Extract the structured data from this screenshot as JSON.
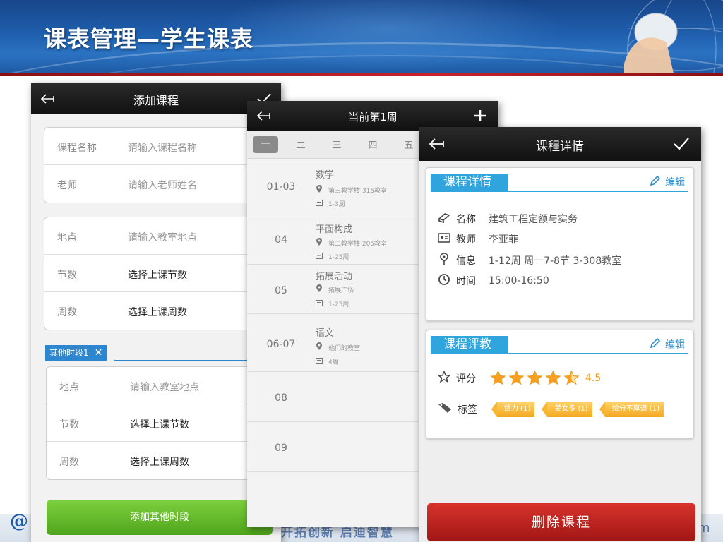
{
  "slide": {
    "title": "课表管理—学生课表",
    "footer_logo": "@",
    "footer_slogan": "开拓创新 启迪智慧",
    "footer_right": "m"
  },
  "add_course": {
    "title": "添加课程",
    "name_label": "课程名称",
    "name_placeholder": "请输入课程名称",
    "teacher_label": "老师",
    "teacher_placeholder": "请输入老师姓名",
    "location_label": "地点",
    "location_placeholder": "请输入教室地点",
    "periods_label": "节数",
    "periods_value": "选择上课节数",
    "weeks_label": "周数",
    "weeks_value": "选择上课周数",
    "other_period_tag": "其他时段1",
    "other_location_label": "地点",
    "other_location_placeholder": "请输入教室地点",
    "other_periods_label": "节数",
    "other_periods_value": "选择上课节数",
    "other_weeks_label": "周数",
    "other_weeks_value": "选择上课周数",
    "add_period_button": "添加其他时段"
  },
  "schedule": {
    "title": "当前第1周",
    "days": [
      "一",
      "二",
      "三",
      "四",
      "五"
    ],
    "rows": [
      {
        "period": "01-03",
        "course": "数学",
        "room": "第三教学楼 315教室",
        "weeks": "1-3周"
      },
      {
        "period": "04",
        "course": "平面构成",
        "room": "第二教学楼 205教室",
        "weeks": "1-25周"
      },
      {
        "period": "05",
        "course": "拓展活动",
        "room": "拓展广场",
        "weeks": "1-25周"
      },
      {
        "period": "06-07",
        "course": "语文",
        "room": "他们的教室",
        "weeks": "4周"
      },
      {
        "period": "08",
        "course": "",
        "room": "",
        "weeks": ""
      },
      {
        "period": "09",
        "course": "",
        "room": "",
        "weeks": ""
      }
    ]
  },
  "detail": {
    "title": "课程详情",
    "section1_title": "课程详情",
    "edit_label": "编辑",
    "name_key": "名称",
    "name_value": "建筑工程定额与实务",
    "teacher_key": "教师",
    "teacher_value": "李亚菲",
    "info_key": "信息",
    "info_value": "1-12周 周一7-8节 3-308教室",
    "time_key": "时间",
    "time_value": "15:00-16:50",
    "section2_title": "课程评教",
    "rating_key": "评分",
    "rating_value": "4.5",
    "rating": 4.5,
    "tags_key": "标签",
    "tags": [
      "给力 (1)",
      "美女多 (1)",
      "给分不厚道 (1)"
    ],
    "delete_button": "删除课程"
  }
}
